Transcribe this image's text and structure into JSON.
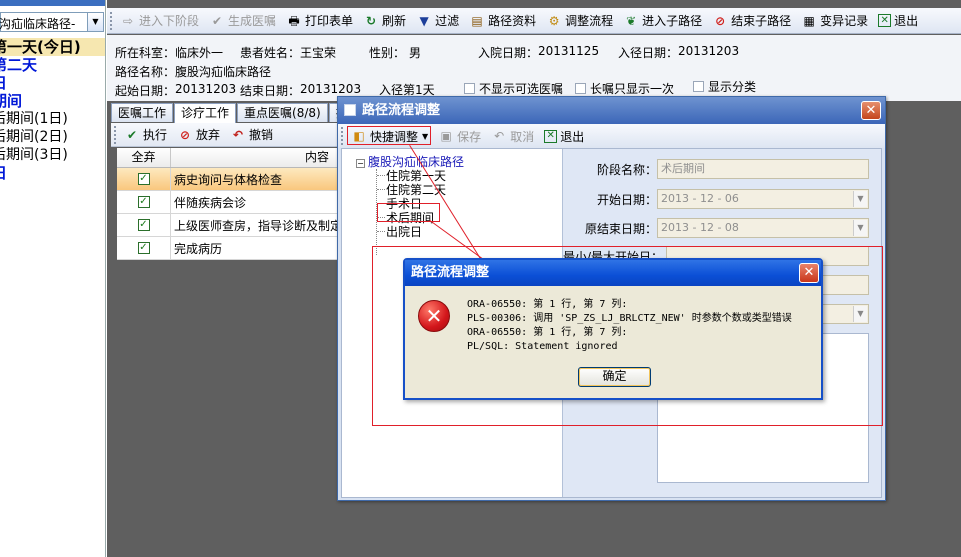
{
  "left_panel": {
    "combo_text": "沟疝临床路径-",
    "items": [
      {
        "text": "第一天(今日)",
        "style": "bold hl"
      },
      {
        "text": "第二天",
        "style": "bold blue"
      },
      {
        "text": "日",
        "style": "bold blue"
      },
      {
        "text": "期间",
        "style": "bold blue"
      },
      {
        "text": "后期间(1日)",
        "style": "small"
      },
      {
        "text": "后期间(2日)",
        "style": "small"
      },
      {
        "text": "后期间(3日)",
        "style": "small"
      },
      {
        "text": "日",
        "style": "bold blue"
      }
    ]
  },
  "toolbar": {
    "next_stage": "进入下阶段",
    "gen_order": "生成医嘱",
    "print_form": "打印表单",
    "refresh": "刷新",
    "filter": "过滤",
    "path_info": "路径资料",
    "adjust_flow": "调整流程",
    "enter_sub": "进入子路径",
    "end_sub": "结束子路径",
    "change_log": "变异记录",
    "exit": "退出"
  },
  "patient_info": {
    "dept_label": "所在科室：",
    "dept": "临床外一",
    "name_label": "患者姓名：",
    "name": "王宝荣",
    "sex_label": "性别：",
    "sex": "男",
    "admit_label": "入院日期：",
    "admit": "20131125",
    "enter_label": "入径日期：",
    "enter": "20131203",
    "path_label": "路径名称：",
    "path": "腹股沟疝临床路径",
    "start_label": "起始日期：",
    "start": "20131203",
    "end_label": "结束日期：",
    "end": "20131203",
    "day_label": "入径第1天",
    "opt_hide_optional": "不显示可选医嘱",
    "opt_long_once": "长嘱只显示一次",
    "opt_show_cat": "显示分类"
  },
  "tabs": [
    "医嘱工作",
    "诊疗工作",
    "重点医嘱(8/8)",
    "护"
  ],
  "sub_toolbar": {
    "execute": "执行",
    "abandon": "放弃",
    "undo": "撤销"
  },
  "table": {
    "headers": {
      "all": "全弃",
      "content": "内容"
    },
    "rows": [
      "病史询问与体格检查",
      "伴随疾病会诊",
      "上级医师查房，指导诊断及制定",
      "完成病历"
    ]
  },
  "path_window": {
    "title": "路径流程调整",
    "quick_adjust": "快捷调整",
    "save": "保存",
    "cancel": "取消",
    "exit": "退出",
    "tree_root": "腹股沟疝临床路径",
    "tree_items": [
      "住院第一天",
      "住院第二天",
      "手术日",
      "术后期间",
      "出院日"
    ],
    "stage_label": "阶段名称：",
    "stage_value": "术后期间",
    "start_label": "开始日期：",
    "start_value": "2013 - 12 - 06",
    "orig_end_label": "原结束日期：",
    "orig_end_value": "2013 - 12 - 08",
    "min_max_label": "最小/最大开始日："
  },
  "error_dialog": {
    "title": "路径流程调整",
    "message": "ORA-06550: 第 1 行, 第 7 列:\nPLS-00306: 调用 'SP_ZS_LJ_BRLCTZ_NEW' 时参数个数或类型错误\nORA-06550: 第 1 行, 第 7 列:\nPL/SQL: Statement ignored",
    "ok": "确定"
  }
}
